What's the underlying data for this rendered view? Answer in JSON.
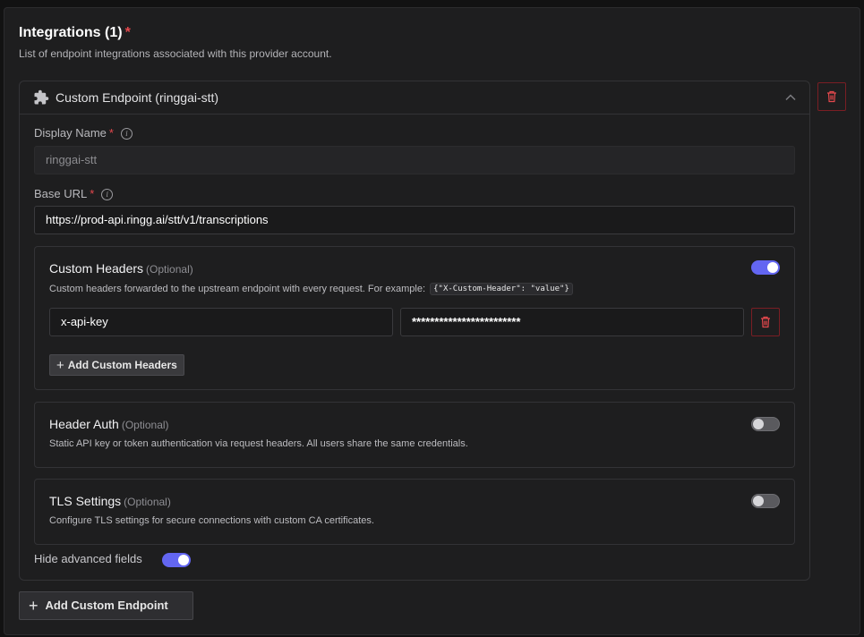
{
  "section": {
    "title": "Integrations (1)",
    "required_mark": "*",
    "subtitle": "List of endpoint integrations associated with this provider account."
  },
  "endpoint": {
    "title": "Custom Endpoint (ringgai-stt)",
    "display_name": {
      "label": "Display Name",
      "required_mark": "*",
      "value": "ringgai-stt"
    },
    "base_url": {
      "label": "Base URL",
      "required_mark": "*",
      "value": "https://prod-api.ringg.ai/stt/v1/transcriptions"
    },
    "custom_headers": {
      "title": "Custom Headers",
      "optional": "(Optional)",
      "enabled": true,
      "description": "Custom headers forwarded to the upstream endpoint with every request. For example:",
      "example_code": "{\"X-Custom-Header\": \"value\"}",
      "rows": [
        {
          "key": "x-api-key",
          "value": "************************"
        }
      ],
      "add_label": "Add Custom Headers"
    },
    "header_auth": {
      "title": "Header Auth",
      "optional": "(Optional)",
      "enabled": false,
      "description": "Static API key or token authentication via request headers. All users share the same credentials."
    },
    "tls_settings": {
      "title": "TLS Settings",
      "optional": "(Optional)",
      "enabled": false,
      "description": "Configure TLS settings for secure connections with custom CA certificates."
    },
    "hide_advanced": {
      "label": "Hide advanced fields",
      "enabled": true
    }
  },
  "add_endpoint_label": "Add Custom Endpoint",
  "icons": {
    "endpoint": "puzzle-icon",
    "collapse": "chevron-up-icon",
    "delete": "trash-icon",
    "info": "info-icon",
    "add": "plus-icon"
  },
  "colors": {
    "accent": "#6366f1",
    "danger": "#e5484d",
    "background": "#1e1e1f"
  }
}
